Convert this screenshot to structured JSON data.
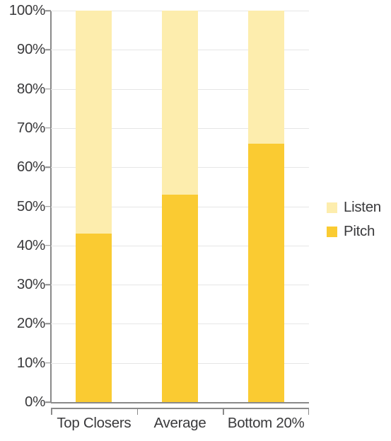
{
  "chart_data": {
    "type": "bar",
    "subtype": "stacked-100-percent",
    "title": "",
    "subtitle": "",
    "xlabel": "",
    "ylabel": "",
    "categories": [
      "Top Closers",
      "Average",
      "Bottom 20%"
    ],
    "series": [
      {
        "name": "Listen",
        "values": [
          57,
          47,
          34
        ],
        "color": "#fdedad"
      },
      {
        "name": "Pitch",
        "values": [
          43,
          53,
          66
        ],
        "color": "#facb32"
      }
    ],
    "stack_order_bottom_to_top": [
      "Pitch",
      "Listen"
    ],
    "ylim": [
      0,
      100
    ],
    "ytick_values": [
      0,
      10,
      20,
      30,
      40,
      50,
      60,
      70,
      80,
      90,
      100
    ],
    "ytick_labels": [
      "0%",
      "10%",
      "20%",
      "30%",
      "40%",
      "50%",
      "60%",
      "70%",
      "80%",
      "90%",
      "100%"
    ],
    "grid": true,
    "grid_axis": "y",
    "legend_position": "right",
    "legend_entries": [
      "Listen",
      "Pitch"
    ],
    "value_format": "percent"
  },
  "colors": {
    "listen": "#fdedad",
    "pitch": "#facb32",
    "text": "#3a3a3c",
    "gridline": "#e6e6e6",
    "axis": "#8a8a8a",
    "background": "#ffffff"
  },
  "legend": {
    "items": [
      {
        "label": "Listen",
        "swatch_name": "legend-swatch-listen"
      },
      {
        "label": "Pitch",
        "swatch_name": "legend-swatch-pitch"
      }
    ]
  }
}
